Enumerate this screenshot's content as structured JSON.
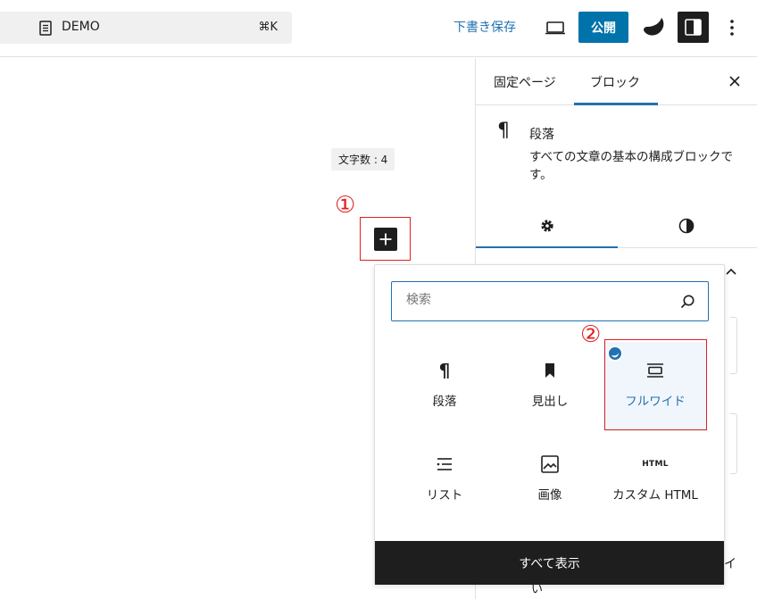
{
  "topbar": {
    "document_title": "DEMO",
    "shortcut": "⌘K",
    "save_draft": "下書き保存",
    "publish": "公開"
  },
  "canvas": {
    "char_count": "文字数 : 4",
    "annotation_1": "①",
    "annotation_2": "②"
  },
  "sidebar": {
    "tabs": [
      {
        "label": "固定ページ",
        "active": false
      },
      {
        "label": "ブロック",
        "active": true
      }
    ],
    "block": {
      "name": "段落",
      "description": "すべての文章の基本の構成ブロックです。"
    },
    "partial_text_1": "イ",
    "partial_text_2": "い"
  },
  "inserter": {
    "search_placeholder": "検索",
    "blocks": [
      {
        "label": "段落",
        "icon": "paragraph-icon"
      },
      {
        "label": "見出し",
        "icon": "heading-bookmark-icon"
      },
      {
        "label": "フルワイド",
        "icon": "fullwide-icon",
        "selected": true
      },
      {
        "label": "リスト",
        "icon": "list-icon"
      },
      {
        "label": "画像",
        "icon": "image-icon"
      },
      {
        "label": "カスタム HTML",
        "icon": "html-icon",
        "icon_text": "HTML"
      }
    ],
    "browse_all": "すべて表示"
  },
  "colors": {
    "accent": "#2271b1",
    "publish": "#0073aa",
    "dark": "#1e1e1e",
    "annotation": "#e02020"
  }
}
